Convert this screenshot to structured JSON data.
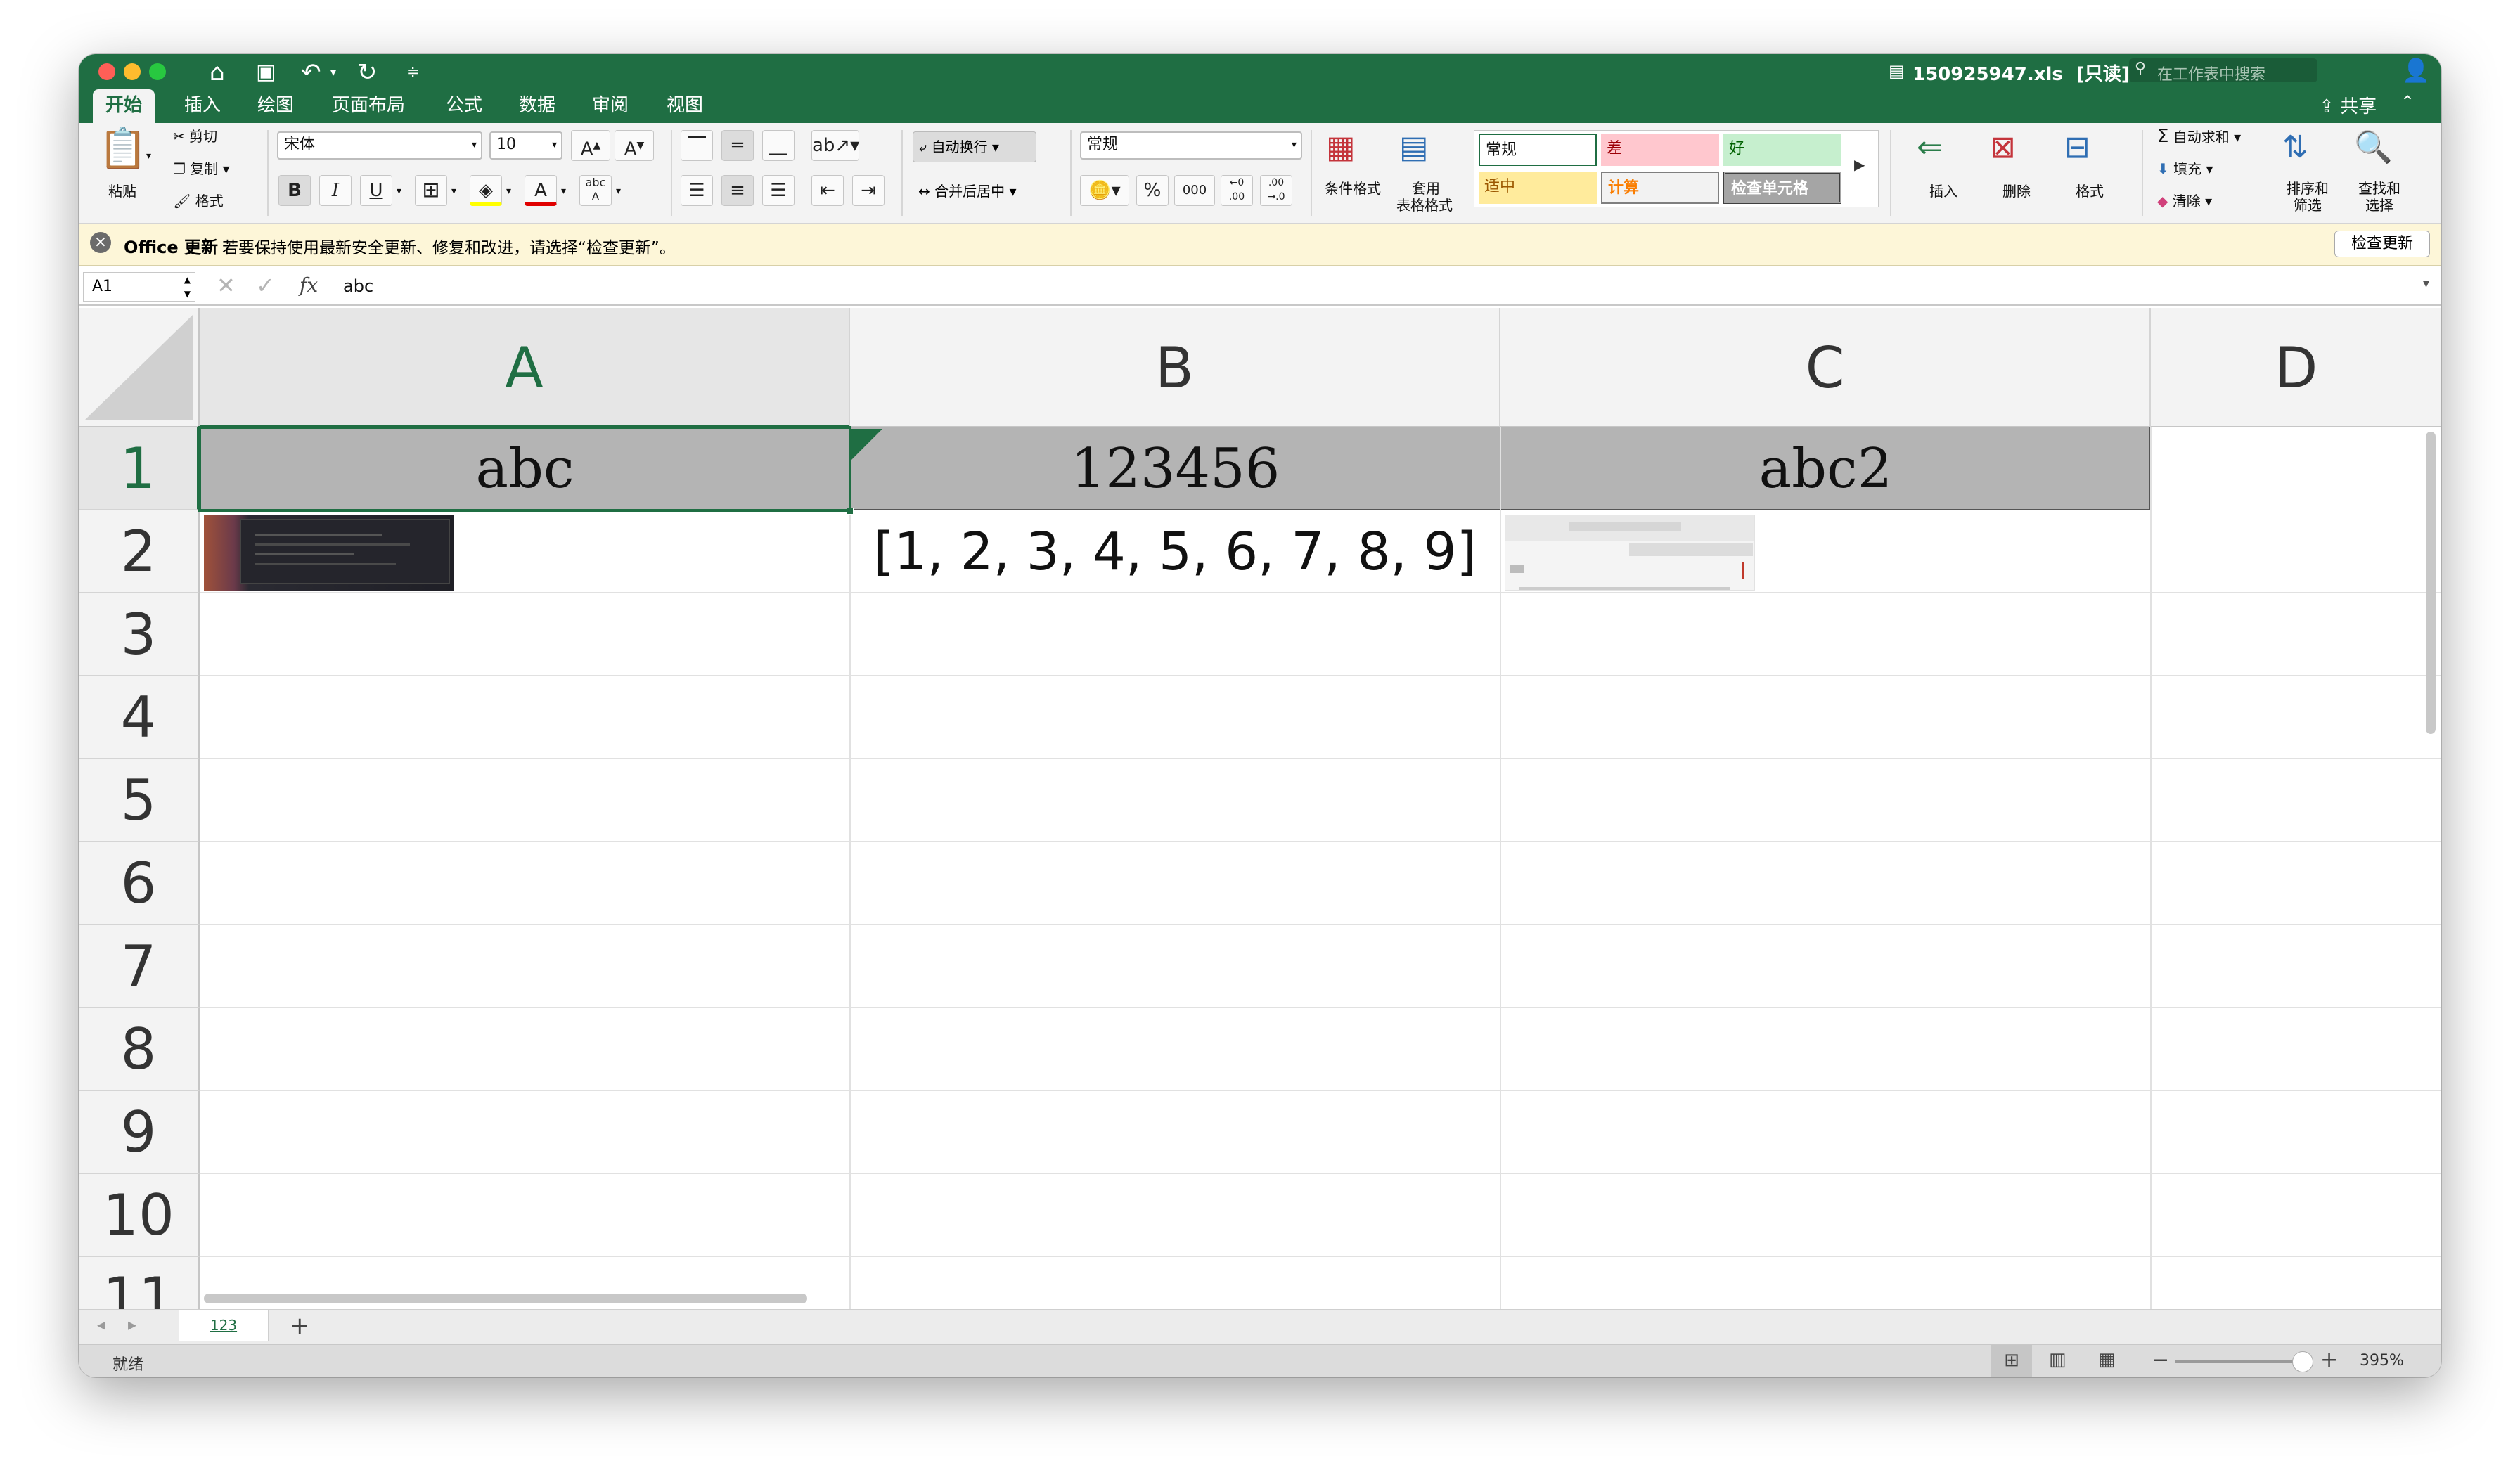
{
  "titlebar": {
    "filename": "150925947.xls",
    "readonly": "[只读]",
    "search_placeholder": "在工作表中搜索"
  },
  "tabs": [
    "开始",
    "插入",
    "绘图",
    "页面布局",
    "公式",
    "数据",
    "审阅",
    "视图"
  ],
  "share_label": "共享",
  "ribbon": {
    "paste": "粘贴",
    "cut": "剪切",
    "copy": "复制",
    "format_painter": "格式",
    "font_name": "宋体",
    "font_size": "10",
    "bold": "B",
    "italic": "I",
    "underline": "U",
    "wrap_text": "自动换行",
    "merge_center": "合并后居中",
    "number_format": "常规",
    "percent": "%",
    "thousands": "000",
    "cond_format": "条件格式",
    "table_format_1": "套用",
    "table_format_2": "表格格式",
    "styles": {
      "normal": "常规",
      "bad": "差",
      "good": "好",
      "neutral": "适中",
      "calculation": "计算",
      "check_cell": "检查单元格"
    },
    "insert": "插入",
    "delete": "删除",
    "format": "格式",
    "autosum": "自动求和",
    "fill": "填充",
    "clear": "清除",
    "sort_filter_1": "排序和",
    "sort_filter_2": "筛选",
    "find_select_1": "查找和",
    "find_select_2": "选择"
  },
  "message_bar": {
    "title": "Office 更新",
    "text": "若要保持使用最新安全更新、修复和改进，请选择“检查更新”。",
    "button": "检查更新"
  },
  "formula_bar": {
    "name_box": "A1",
    "fx": "fx",
    "content": "abc"
  },
  "columns": [
    "A",
    "B",
    "C",
    "D"
  ],
  "rows": [
    "1",
    "2",
    "3",
    "4",
    "5",
    "6",
    "7",
    "8",
    "9",
    "10",
    "11"
  ],
  "cells": {
    "A1": "abc",
    "B1": "123456",
    "C1": "abc2",
    "B2": "[1, 2, 3, 4, 5, 6, 7, 8, 9]"
  },
  "sheet_tab": "123",
  "status": {
    "ready": "就绪",
    "zoom": "395%"
  },
  "colors": {
    "excel_green": "#1f6e43",
    "header_fill": "#b4b4b4",
    "style_bad": "#ffc7ce",
    "style_good": "#c6efce",
    "style_neutral": "#ffeb9c"
  }
}
